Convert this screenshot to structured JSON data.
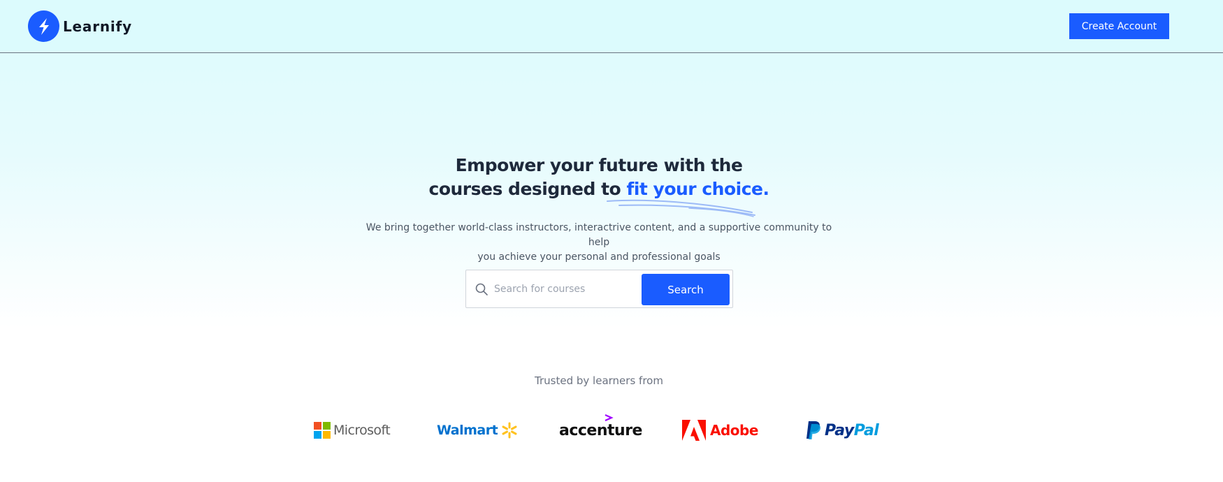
{
  "header": {
    "brand_name": "Learnify",
    "cta_label": "Create Account"
  },
  "hero": {
    "title_line1": "Empower your future with the",
    "title_line2_plain": "courses designed to ",
    "title_line2_accent": "fit your choice.",
    "subtitle_line1": "We bring together world-class instructors, interactrive content, and a supportive community to help",
    "subtitle_line2": "you achieve your personal and professional goals"
  },
  "search": {
    "placeholder": "Search for courses",
    "value": "",
    "button_label": "Search"
  },
  "trusted": {
    "label": "Trusted by learners from",
    "logos": [
      "Microsoft",
      "Walmart",
      "accenture",
      "Adobe",
      "PayPal"
    ],
    "paypal_parts": [
      "Pay",
      "Pal"
    ]
  },
  "colors": {
    "accent": "#1a5cff",
    "heading": "#1e293b",
    "muted": "#6b7280",
    "background_top": "#dcfbfd"
  },
  "icons": {
    "logo": "lightning-bolt-icon",
    "search": "search-icon"
  }
}
